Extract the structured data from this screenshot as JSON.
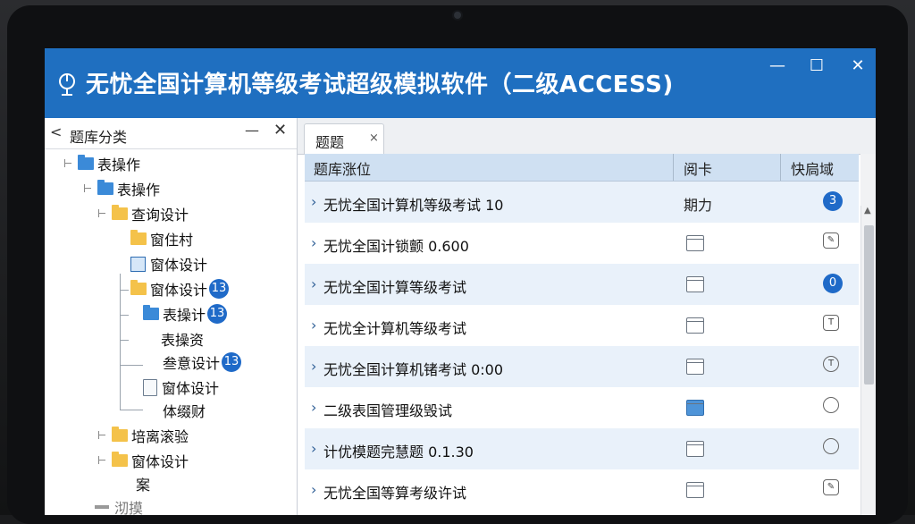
{
  "window": {
    "title": "无忧全国计算机等级考试超级模拟软件（二级ACCESS)",
    "controls": {
      "minimize": "—",
      "maximize": "☐",
      "close": "✕"
    }
  },
  "sidebar": {
    "header": {
      "back": "<",
      "title": "题库分类",
      "minimize": "—",
      "close": "✕"
    },
    "tree": [
      {
        "label": "表操作"
      },
      {
        "label": "表操作"
      },
      {
        "label": "查询设计"
      },
      {
        "label": "窗住村"
      },
      {
        "label": "窗体设计"
      },
      {
        "label": "窗体设计",
        "badge": "13"
      },
      {
        "label": "表操计",
        "badge": "13"
      },
      {
        "label": "表操资"
      },
      {
        "label": "叁意设计",
        "badge": "13"
      },
      {
        "label": "窗体设计"
      },
      {
        "label": "体缀财"
      },
      {
        "label": "培离滚验"
      },
      {
        "label": "窗体设计"
      },
      {
        "label": "案"
      },
      {
        "label": "沏摸"
      }
    ]
  },
  "main": {
    "tab": {
      "label": "题题",
      "close": "×"
    },
    "columns": [
      "题库涨位",
      "阅卡",
      "快扃域"
    ],
    "rows": [
      {
        "name": "无忧全国计算机等级考试  10",
        "col2": "期力",
        "status": "3",
        "status_type": "badge"
      },
      {
        "name": "无忧全国计锁颤 0.600",
        "col2": "",
        "icon": "file",
        "status": "",
        "status_type": "icon"
      },
      {
        "name": "无忧全国计算等级考试",
        "col2": "",
        "icon": "file",
        "status": "0",
        "status_type": "badge"
      },
      {
        "name": "无忧全计算机等级考试",
        "col2": "",
        "icon": "file",
        "status": "",
        "status_type": "icon"
      },
      {
        "name": "无忧全国计算机锗考试 0:00",
        "col2": "",
        "icon": "file",
        "status": "",
        "status_type": "icon"
      },
      {
        "name": "二级表国管理级毁试",
        "col2": "",
        "icon": "file-blue",
        "status": "",
        "status_type": "round"
      },
      {
        "name": "计优模题完慧题 0.1.30",
        "col2": "",
        "icon": "file",
        "status": "",
        "status_type": "round"
      },
      {
        "name": "无忧全国等算考级许试",
        "col2": "",
        "icon": "file",
        "status": "",
        "status_type": "icon"
      }
    ]
  },
  "colors": {
    "titlebar": "#1f6fc0",
    "header_row": "#cfe0f2",
    "alt_row": "#e9f1fa",
    "badge": "#1f6ac8"
  }
}
